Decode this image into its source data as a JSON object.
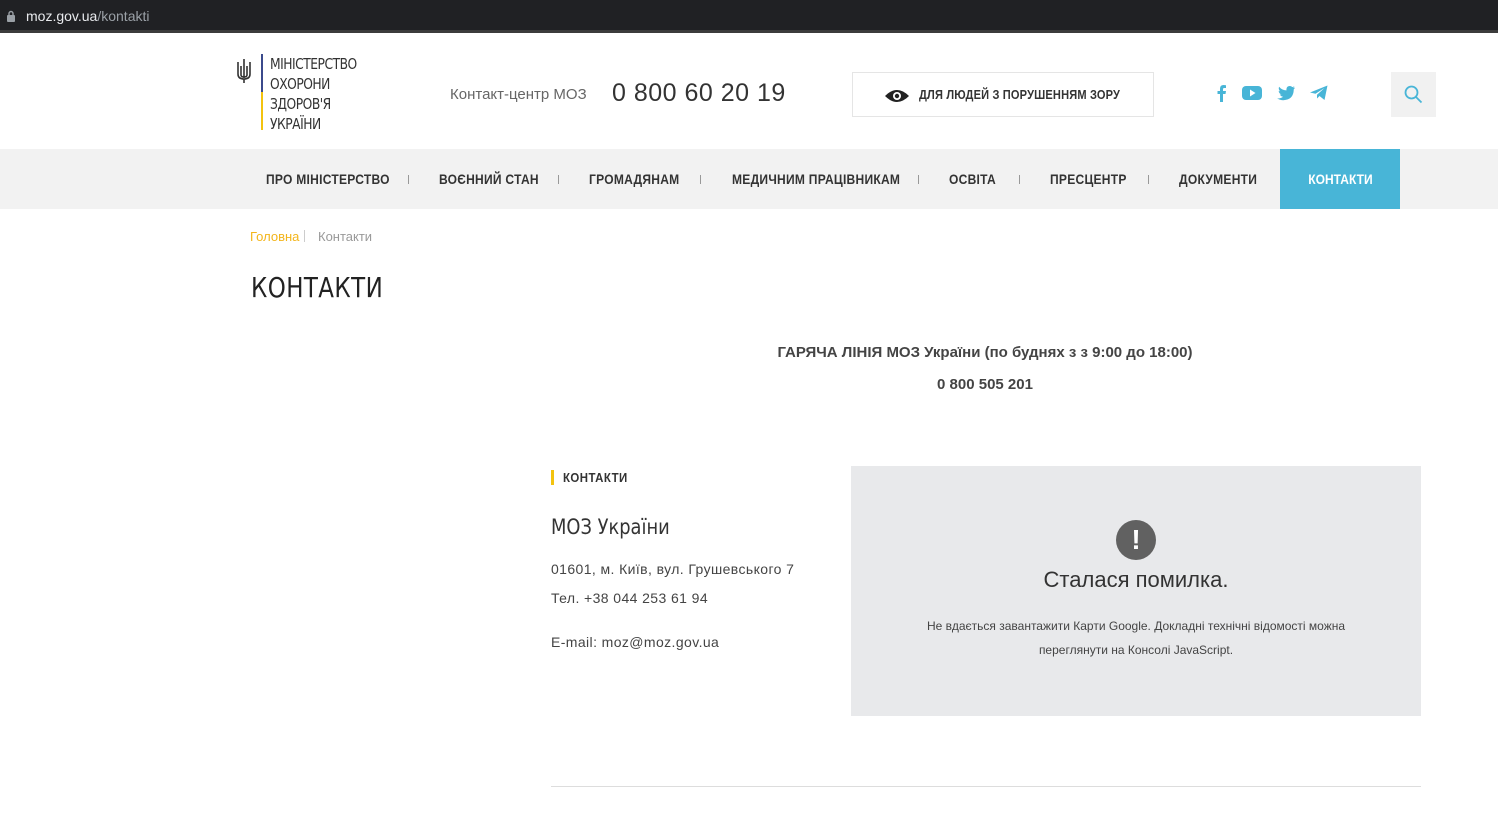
{
  "browser": {
    "url_host": "moz.gov.ua",
    "url_path": "/kontakti"
  },
  "header": {
    "logo_lines": [
      "Міністерство",
      "охорони",
      "здоров'я",
      "України"
    ],
    "contact_label": "Контакт-центр МОЗ",
    "contact_phone": "0 800 60 20 19",
    "vision_button": "Для людей з порушенням зору",
    "social_icons": [
      "facebook-icon",
      "youtube-icon",
      "twitter-icon",
      "telegram-icon"
    ]
  },
  "nav": {
    "items": [
      "Про Міністерство",
      "Воєнний стан",
      "Громадянам",
      "Медичним працівникам",
      "Освіта",
      "Пресцентр",
      "Документи"
    ],
    "active": "Контакти"
  },
  "breadcrumb": {
    "home": "Головна",
    "current": "Контакти"
  },
  "page": {
    "title": "Контакти",
    "hotline_title": "ГАРЯЧА ЛІНІЯ МОЗ України (по буднях з з 9:00 до 18:00)",
    "hotline_phone": "0 800 505 201"
  },
  "contacts": {
    "heading": "Контакти",
    "org_name": "МОЗ України",
    "address": "01601, м. Київ, вул. Грушевського 7",
    "phone": "Тел. +38 044 253 61 94",
    "email": "E-mail: moz@moz.gov.ua"
  },
  "map": {
    "error_icon": "!",
    "error_title": "Сталася помилка.",
    "error_text": "Не вдається завантажити Карти Google. Докладні технічні відомості можна переглянути на Консолі JavaScript."
  },
  "colors": {
    "accent_blue": "#48b5d7",
    "accent_yellow": "#f3c30f",
    "crumb_link": "#f3b51b"
  }
}
